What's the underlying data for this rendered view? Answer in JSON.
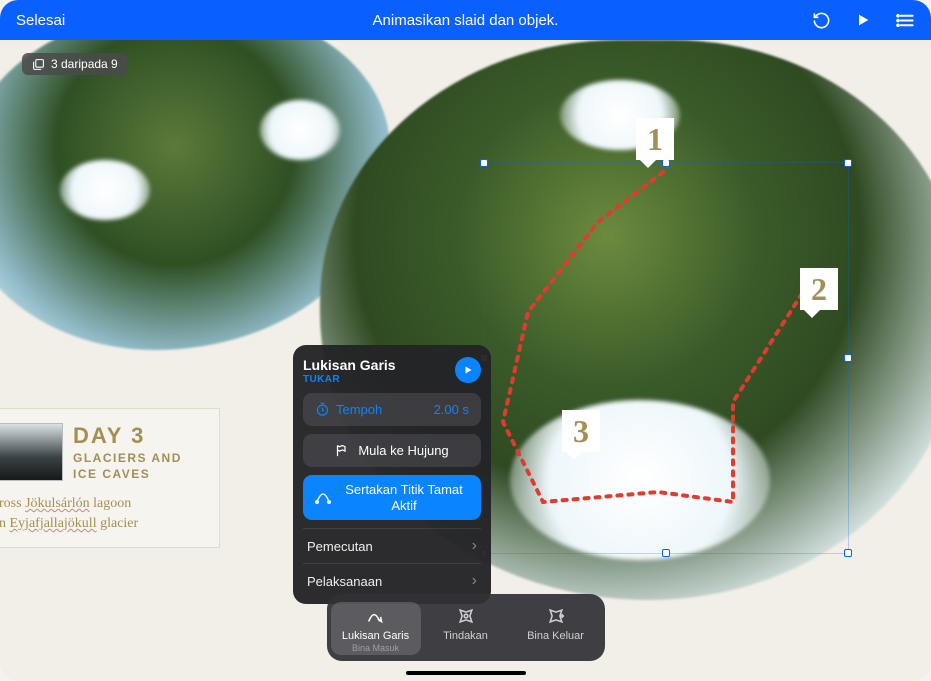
{
  "topbar": {
    "done": "Selesai",
    "title": "Animasikan slaid dan objek."
  },
  "slide_counter": "3 daripada 9",
  "markers": {
    "one": "1",
    "two": "2",
    "three": "3"
  },
  "day_card": {
    "title": "DAY 3",
    "subtitle": "GLACIERS AND ICE CAVES",
    "line1_a": "ross ",
    "line1_b": "Jökulsárlón",
    "line1_c": " lagoon",
    "line2_a": "n ",
    "line2_b": "Eyjafjallajökull",
    "line2_c": " glacier"
  },
  "anim_panel": {
    "title": "Lukisan Garis",
    "swap": "TUKAR",
    "duration_label": "Tempoh",
    "duration_value": "2.00 s",
    "start_to_end": "Mula ke Hujung",
    "include_endpoint": "Sertakan Titik Tamat Aktif",
    "acceleration": "Pemecutan",
    "delivery": "Pelaksanaan"
  },
  "bottom_bar": {
    "build_in_label": "Lukisan Garis",
    "build_in_sub": "Bina Masuk",
    "action": "Tindakan",
    "build_out": "Bina Keluar"
  }
}
